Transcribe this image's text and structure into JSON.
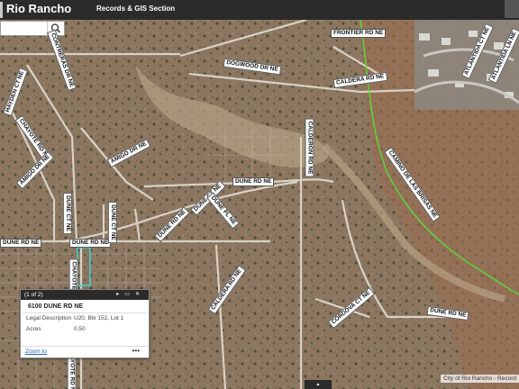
{
  "app": {
    "title": "Rio Rancho",
    "section": "Records & GIS Section"
  },
  "search": {
    "value": "",
    "placeholder": "",
    "icon": "search-icon"
  },
  "roads": [
    {
      "id": "frontier",
      "label": "FRONTIER RD NE"
    },
    {
      "id": "dogwood",
      "label": "DOGWOOD DR NE"
    },
    {
      "id": "caldera1",
      "label": "CALDERA RD NE"
    },
    {
      "id": "chayote1",
      "label": "CHAYOTE RD NE"
    },
    {
      "id": "amigo1",
      "label": "AMIGO DR NE"
    },
    {
      "id": "amigo2",
      "label": "AMIGO DR NE"
    },
    {
      "id": "calderon",
      "label": "CALDERON RD NE"
    },
    {
      "id": "dune_rd_top",
      "label": "DUNE RD NE"
    },
    {
      "id": "dune_ct1",
      "label": "DUNE CT NE"
    },
    {
      "id": "dune_pl",
      "label": "DUNE PL NE"
    },
    {
      "id": "dune_rd_mid",
      "label": "DUNE RD NE"
    },
    {
      "id": "dune_rd_left",
      "label": "DUNE RD NE"
    },
    {
      "id": "dune_rd_left2",
      "label": "DUNE RD NE"
    },
    {
      "id": "dune_ct2",
      "label": "DUNE CT NE"
    },
    {
      "id": "dune_ct3",
      "label": "DUNE CT NE"
    },
    {
      "id": "chayote2",
      "label": "CHAYOTE RD NE"
    },
    {
      "id": "chayote3",
      "label": "CHAYOTE RD NE"
    },
    {
      "id": "camino",
      "label": "CAMINO DE LAS BRISAS NE"
    },
    {
      "id": "cordova",
      "label": "CORDOVA CT NE"
    },
    {
      "id": "dune_rd_right",
      "label": "DUNE RD NE"
    },
    {
      "id": "caldera2",
      "label": "CALDERA RD NE"
    },
    {
      "id": "hayden",
      "label": "HAYDEN CT NE"
    },
    {
      "id": "contreras",
      "label": "CONTRERAS DR NE"
    },
    {
      "id": "atlantida",
      "label": "ATLANTIDA CT NE"
    },
    {
      "id": "atlantida2",
      "label": "ATLANTIDA LN NE"
    }
  ],
  "popup": {
    "counter": "(1 of 2)",
    "title": "6100 DUNE RD NE",
    "fields": [
      {
        "label": "Legal Description",
        "value": "U20, Blk 152, Lot 1"
      },
      {
        "label": "Acres",
        "value": "0.50"
      }
    ],
    "zoom_link": "Zoom to",
    "more": "•••"
  },
  "attribution": "City of Rio Rancho - Record",
  "colors": {
    "topbar": "#2b2b2b",
    "terrain": "#8a7560",
    "road_line": "#d9d2c6",
    "parcel_highlight": "#39d6d6",
    "city_limit": "#5bd63a"
  }
}
